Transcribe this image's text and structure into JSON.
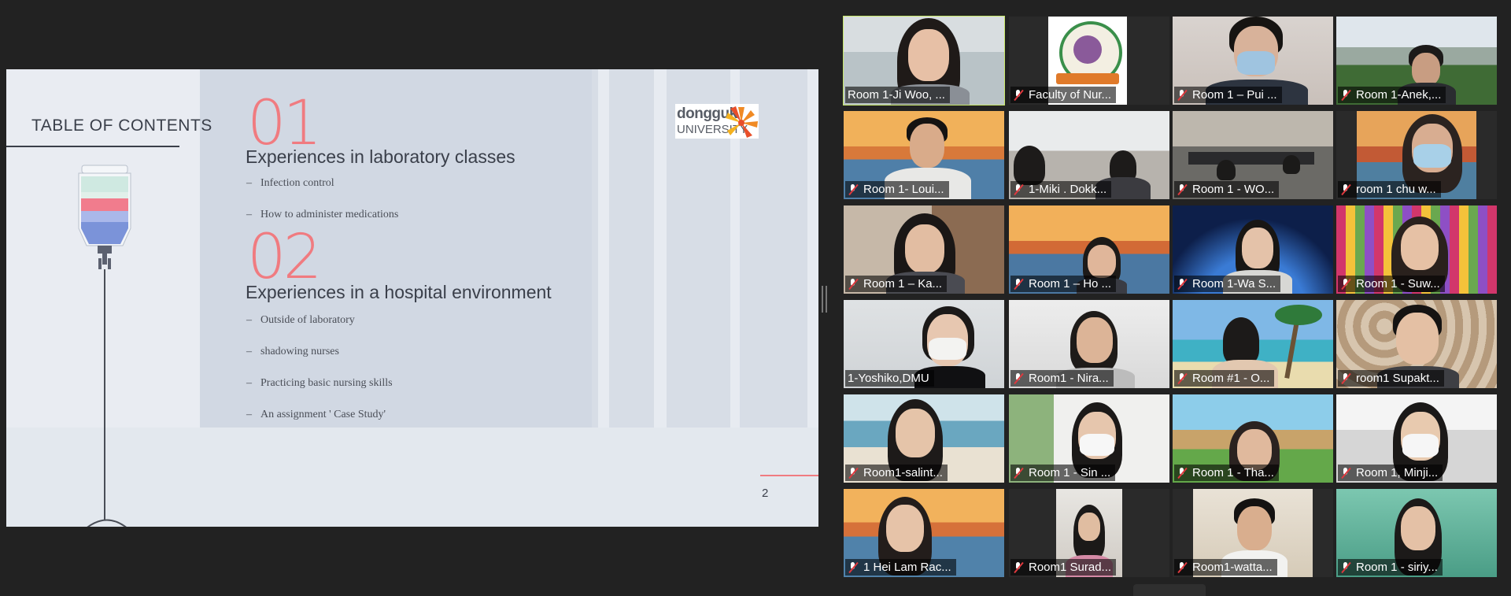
{
  "slide": {
    "toc_title": "TABLE OF CONTENTS",
    "section1": {
      "number": "01",
      "heading": "Experiences in laboratory classes",
      "items": [
        "Infection control",
        "How to administer medications"
      ]
    },
    "section2": {
      "number": "02",
      "heading": "Experiences in a hospital environment",
      "items": [
        "Outside of laboratory",
        "shadowing nurses",
        "Practicing basic nursing skills",
        "An assignment ' Case Study'"
      ]
    },
    "logo_line1": "dongguk",
    "logo_line2": "UNIVERSITY",
    "page_number": "2",
    "bullet_dash": "–"
  },
  "participants": [
    {
      "name": "Room 1-Ji Woo, ...",
      "muted": false,
      "active": true
    },
    {
      "name": "Faculty of Nur...",
      "muted": true
    },
    {
      "name": "Room 1 – Pui ...",
      "muted": true
    },
    {
      "name": "Room 1-Anek,...",
      "muted": true
    },
    {
      "name": "Room 1- Loui...",
      "muted": true
    },
    {
      "name": "1-Miki . Dokk...",
      "muted": true
    },
    {
      "name": "Room 1 - WO...",
      "muted": true
    },
    {
      "name": "room 1 chu w...",
      "muted": true
    },
    {
      "name": "Room 1 – Ka...",
      "muted": true
    },
    {
      "name": "Room 1 – Ho ...",
      "muted": true
    },
    {
      "name": "Room 1-Wa S...",
      "muted": true
    },
    {
      "name": "Room 1 - Suw...",
      "muted": true
    },
    {
      "name": "1-Yoshiko,DMU",
      "muted": false
    },
    {
      "name": "Room1 - Nira...",
      "muted": true
    },
    {
      "name": "Room #1 - O...",
      "muted": true
    },
    {
      "name": "room1 Supakt...",
      "muted": true
    },
    {
      "name": "Room1-salint...",
      "muted": true
    },
    {
      "name": "Room 1 - Sin ...",
      "muted": true
    },
    {
      "name": "Room 1 - Tha...",
      "muted": true
    },
    {
      "name": "Room 1, Minji...",
      "muted": true
    },
    {
      "name": "1 Hei Lam Rac...",
      "muted": true
    },
    {
      "name": "Room1 Surad...",
      "muted": true
    },
    {
      "name": "Room1-watta...",
      "muted": true
    },
    {
      "name": "Room 1 - siriy...",
      "muted": true
    }
  ]
}
